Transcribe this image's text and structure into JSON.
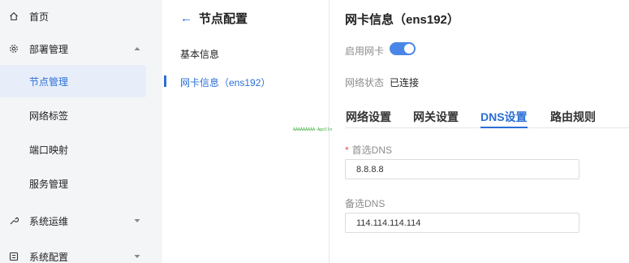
{
  "sidebar": {
    "items": [
      {
        "label": "首页",
        "icon": "home-icon"
      },
      {
        "label": "部署管理",
        "icon": "gear-icon",
        "expanded": true
      },
      {
        "label": "节点管理",
        "active": true
      },
      {
        "label": "网络标签"
      },
      {
        "label": "端口映射"
      },
      {
        "label": "服务管理"
      },
      {
        "label": "系统运维",
        "icon": "wrench-icon",
        "expanded": false
      },
      {
        "label": "系统配置",
        "icon": "config-icon",
        "expanded": false
      }
    ]
  },
  "middle": {
    "title": "节点配置",
    "items": [
      {
        "label": "基本信息"
      },
      {
        "label": "网卡信息（ens192）",
        "active": true
      }
    ],
    "tiny_note": "AAAAAAAAA-Apollo"
  },
  "detail": {
    "title": "网卡信息（ens192）",
    "enable_label": "启用网卡",
    "enable_on": true,
    "status_label": "网络状态",
    "status_value": "已连接",
    "tabs": [
      "网络设置",
      "网关设置",
      "DNS设置",
      "路由规则"
    ],
    "active_tab": "DNS设置",
    "primary_dns_label": "首选DNS",
    "primary_dns_required": "*",
    "primary_dns_value": "8.8.8.8",
    "secondary_dns_label": "备选DNS",
    "secondary_dns_value": "114.114.114.114"
  },
  "colors": {
    "accent": "#2b6fd6",
    "sidebar_bg": "#f4f5f7",
    "required": "#e34d4d"
  }
}
